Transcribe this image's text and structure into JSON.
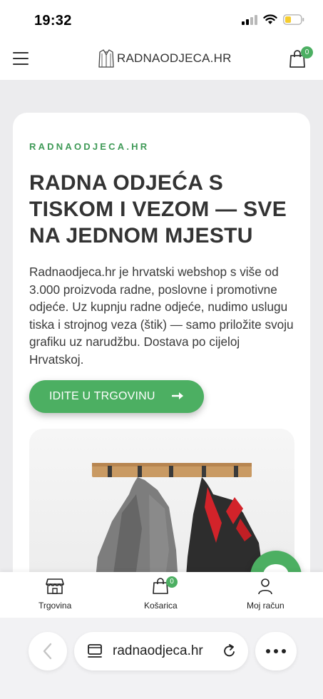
{
  "status_bar": {
    "time": "19:32",
    "signal_icon": "cellular-signal-icon",
    "wifi_icon": "wifi-icon",
    "battery_icon": "battery-low-icon"
  },
  "header": {
    "menu_icon": "hamburger-menu-icon",
    "logo_text": "RADNAODJECA.HR",
    "logo_icon": "shirt-logo-icon",
    "cart_icon": "shopping-bag-icon",
    "cart_count": "0"
  },
  "hero": {
    "eyebrow": "RADNAODJECA.HR",
    "title": "RADNA ODJEĆA S TISKOM I VEZOM — SVE NA JEDNOM MJESTU",
    "description": "Radnaodjeca.hr je hrvatski webshop s više od 3.000 proizvoda radne, poslovne i promotivne odjeće. Uz kupnju radne odjeće, nudimo uslugu tiska i strojnog veza (štik) — samo priložite svoju grafiku uz narudžbu. Dostava po cijeloj Hrvatskoj.",
    "cta_label": "IDITE U TRGOVINU",
    "cta_icon": "arrow-right-icon"
  },
  "bottom_nav": {
    "items": [
      {
        "label": "Trgovina",
        "icon": "store-icon"
      },
      {
        "label": "Košarica",
        "icon": "shopping-bag-icon",
        "count": "0"
      },
      {
        "label": "Moj račun",
        "icon": "user-icon"
      }
    ]
  },
  "chat": {
    "icon": "chat-bubble-icon"
  },
  "browser": {
    "url": "radnaodjeca.hr",
    "back_icon": "chevron-left-icon",
    "page_icon": "page-layout-icon",
    "reload_icon": "reload-icon",
    "more_icon": "more-dots-icon"
  },
  "colors": {
    "accent": "#4caf62",
    "eyebrow": "#3f9a57",
    "text": "#333333",
    "background": "#ececee"
  }
}
